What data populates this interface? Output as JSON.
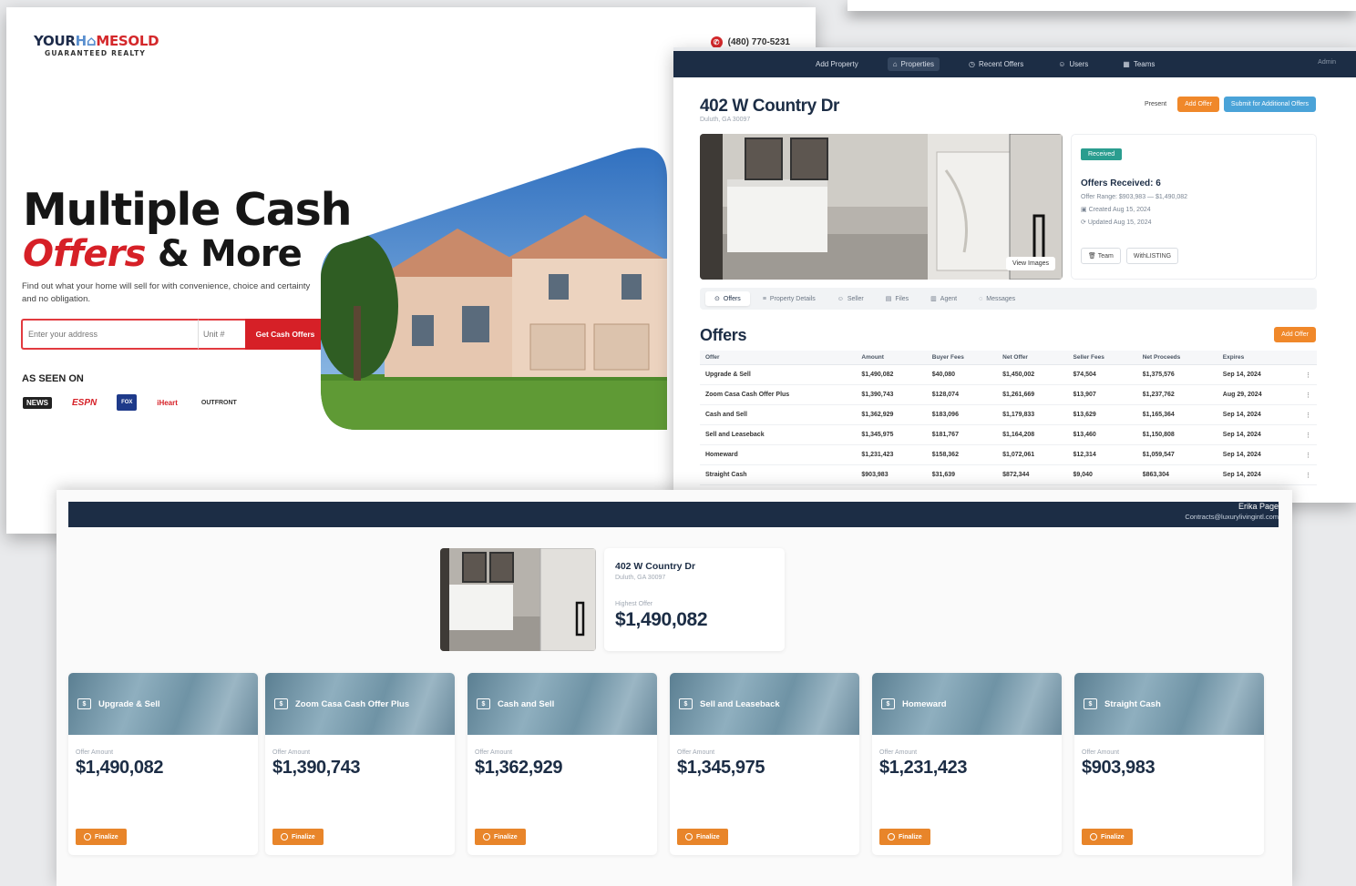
{
  "landing": {
    "logo_line1_a": "YOUR",
    "logo_line1_b": "H",
    "logo_line1_c": "MESOLD",
    "logo_line2": "GUARANTEED REALTY",
    "phone": "(480) 770-5231",
    "hero_line1": "Multiple Cash",
    "hero_accent": "Offers",
    "hero_rest": "& More",
    "subtitle": "Find out what your home will sell for with convenience, choice and certainty and no obligation.",
    "address_placeholder": "Enter your address",
    "unit_placeholder": "Unit #",
    "cta_label": "Get Cash Offers",
    "as_seen_on": "AS SEEN ON",
    "press_logos": [
      "NEWS",
      "ESPN",
      "FOX",
      "iHeart",
      "OUTFRONT"
    ]
  },
  "dashboard": {
    "nav": [
      "Add Property",
      "Properties",
      "Recent Offers",
      "Users",
      "Teams"
    ],
    "nav_active": 1,
    "nav_right": "Admin",
    "property_title": "402 W Country Dr",
    "property_sub": "Duluth, GA 30097",
    "action_buttons": [
      "Present",
      "Add Offer",
      "Submit for Additional Offers"
    ],
    "view_images": "View Images",
    "status_badge": "Received",
    "offers_received": "Offers Received: 6",
    "offer_range": "Offer Range: $903,983 — $1,490,082",
    "created": "Created Aug 15, 2024",
    "updated": "Updated Aug 15, 2024",
    "card_buttons": [
      "Team",
      "WithLISTING"
    ],
    "tabs": [
      "Offers",
      "Property Details",
      "Seller",
      "Files",
      "Agent",
      "Messages"
    ],
    "offers_heading": "Offers",
    "add_offer": "Add Offer",
    "table_headers": [
      "Offer",
      "Amount",
      "Buyer Fees",
      "Net Offer",
      "Seller Fees",
      "Net Proceeds",
      "Expires"
    ],
    "table_rows": [
      [
        "Upgrade & Sell",
        "$1,490,082",
        "$40,080",
        "$1,450,002",
        "$74,504",
        "$1,375,576",
        "Sep 14, 2024"
      ],
      [
        "Zoom Casa Cash Offer Plus",
        "$1,390,743",
        "$128,074",
        "$1,261,669",
        "$13,907",
        "$1,237,762",
        "Aug 29, 2024"
      ],
      [
        "Cash and Sell",
        "$1,362,929",
        "$183,096",
        "$1,179,833",
        "$13,629",
        "$1,165,364",
        "Sep 14, 2024"
      ],
      [
        "Sell and Leaseback",
        "$1,345,975",
        "$181,767",
        "$1,164,208",
        "$13,460",
        "$1,150,808",
        "Sep 14, 2024"
      ],
      [
        "Homeward",
        "$1,231,423",
        "$158,362",
        "$1,072,061",
        "$12,314",
        "$1,059,547",
        "Sep 14, 2024"
      ],
      [
        "Straight Cash",
        "$903,983",
        "$31,639",
        "$872,344",
        "$9,040",
        "$863,304",
        "Sep 14, 2024"
      ]
    ]
  },
  "portal": {
    "user_name": "Erika Page",
    "user_email": "Contracts@luxurylivingintl.com",
    "address": "402 W Country Dr",
    "city": "Duluth, GA 30097",
    "highest_label": "Highest Offer",
    "highest_amount": "$1,490,082",
    "offer_amount_label": "Offer Amount",
    "finalize_label": "Finalize",
    "offers": [
      {
        "name": "Upgrade & Sell",
        "amount": "$1,490,082"
      },
      {
        "name": "Zoom Casa Cash Offer Plus",
        "amount": "$1,390,743"
      },
      {
        "name": "Cash and Sell",
        "amount": "$1,362,929"
      },
      {
        "name": "Sell and Leaseback",
        "amount": "$1,345,975"
      },
      {
        "name": "Homeward",
        "amount": "$1,231,423"
      },
      {
        "name": "Straight Cash",
        "amount": "$903,983"
      }
    ]
  },
  "colors": {
    "navy": "#1c2d45",
    "brand_red": "#d62027",
    "orange": "#e8852a",
    "teal_badge": "#2a9d8f",
    "blue_button": "#4aa3d8"
  }
}
